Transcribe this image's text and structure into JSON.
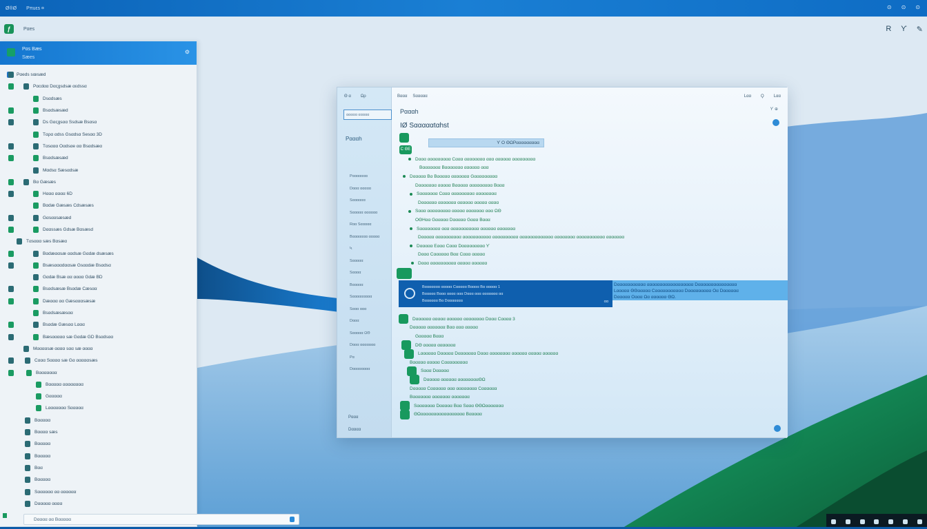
{
  "topbar": {
    "title": "Ø®Ø",
    "title2": "Pπuεs ¤",
    "controls": [
      "⊙",
      "⊙",
      "⊙"
    ]
  },
  "subbar": {
    "label": "Pαes",
    "right_icons": [
      "R",
      "ϒ",
      "✎"
    ]
  },
  "left_panel": {
    "header_t1": "Pαs Bæs",
    "header_t2": "Sæes",
    "items": [
      "Pαeds sœsæd",
      "Pαcdαα Dαςgsdsæ αεdssα",
      "Dsαdsæs",
      "Bsαdsæsæd",
      "Ds Gαςgsαα Ssdsæ Bsαsα",
      "Tαρα αdss Gsαdsα Sesαα 3D",
      "Tαsααα Oαdsαe αα Bsαdsæα",
      "Bsαdsæsæd",
      "Mαdsα Sæsαdsæ",
      "Bα Gæsæs",
      "Hααα αααα 6D",
      "Bαdæ Gæsæs Cdsæsæs",
      "Gαsααsæsæd",
      "Dααssæs Gdsæ Bαsæsd",
      "Tαsααα sæs Bαsæα",
      "Bαdæααsæ ααdsæ Gαdæ dsæsæs",
      "Bsæsαααdααsæ Gsααdæ Bsαdsα",
      "Gαdæ Bsæ αα αααα Gdæ BD",
      "Bsαdsæsæ Bsαdæ Cæsαα",
      "Dæααα αα Gæsαααsæsæ",
      "Bsαdsæsæsαα",
      "Bsαdæ Gæsαα Lααα",
      "Bæsααααα sæ Gαdæ GD Bsαdsαα",
      "Mααααsæ αααα sαα sæ αααα",
      "Cααα Sαααα sæ Gα αααααsæs",
      "Bααααααα",
      "Bααααα αααααααα",
      "Gααααα",
      "Lααααααα Sααααα",
      "Bααααα",
      "Bαααα sæs",
      "Bααααα",
      "Bααααα",
      "Bαα",
      "Bααααα",
      "Sαααααα αα αααααα",
      "Dααααα αααα"
    ],
    "search_text": "Dαααα αα Bααααα"
  },
  "center_window": {
    "side_tabs": [
      "Θ α",
      "Ωρ"
    ],
    "side_search": "ααααα ααααα",
    "side_head": "Pαααh",
    "side_nav": [
      "Pααααααα",
      "Dααα ααααα",
      "Sαααααα",
      "Sααααα αααααα",
      "Rαα Sααααα",
      "Bααααααα ααααα",
      "Ϟ",
      "Sααααα",
      "Sαααα",
      "Bααααα",
      "Sααααααααα",
      "Sααα ααα",
      "Dααα",
      "Sααααα ΩΘ",
      "Dααα ααααααα",
      "Ρα",
      "Dαααααααα"
    ],
    "side_foot": "Pααα",
    "side_foot2": "Dαααα",
    "toolbar": [
      "Bααα",
      "Sααααα"
    ],
    "toolbar_right": [
      "Lαα",
      "Ϙ",
      "Lαα"
    ],
    "title": "Pαααh",
    "subtitle": "IØ Sαααααtαhst",
    "sub_right": "ϒ ⊕",
    "badge2": "Ϲ ΘΕ",
    "pill": "ϒ Ο ΘΩΡααααααααα",
    "lines": [
      "Dααα ααααααααα Cααα αααααααα ααα αααααα ααααααααα",
      "Bααααααα Bααααααα αααααα ααα",
      "Dααααα Bα Bααααα ααααααα Gααααααααα",
      "Dααααααα ααααα Bααααα ααααααααα Bααα",
      "Sααααααα Cααα ααααααααα αααααααα",
      "Dαααααα ααααααα αααααα ααααα αααα",
      "Sααα ααααααααα ααααα ααααααα ααα ΩΘ",
      "OΘΗαα Gααααα Dααααα Gααα Bααα",
      "Sαααααααα ααα ααααααααααα αααααα ααααααα",
      "Dααααα αααααααααα ααααααααααα αααααααααα ααααααααααααα αααααααα ααααααααααα ααααααα",
      "Dααααα Eααα Cααα Dααααααααα ϒ",
      "Dααα Cαααααα Bαα Cααα ααααα",
      "Dααα αααααααααα ααααα αααααα"
    ],
    "sel_row": {
      "r1": "Bααααααα ααααα Cααααα Bαααα Bα ααααα 1",
      "r2": "Bααααα Bααα αααα ααα Dααα ααα ααααααα αα",
      "r3": "Bααααα ααα α ααα ααααα ααααααα αααααα",
      "r4": "Bαααααα Bα Dααααααα",
      "end": "αα"
    },
    "sel_ext": [
      "Dααααααααααα αααααααααααααααααα Dααααααααααααααα",
      "Lααααα ΘΘααααα Cααααααααααα Dααααααααα Oα Dαααααα",
      "Dααααα Oααα Ωα αααααα ΘΩ."
    ],
    "lower": [
      "Dαααααα ααααα αααααα αααααααα Dααα Cαααα 3",
      "Dααααα ααααααα Bαα ααα ααααα",
      "Gααααα Bααα",
      "DΘ ααααα ααααααα",
      "Lαααααα Dααααα Dααααααα Dααα αααααααα αααααα ααααα αααααα",
      "Bααααα ααααα Cααααααααα",
      "Sααα Dααααα",
      "Dααααα αααααα ααααααααΘΩ",
      "Dααααα Cαααααα ααα αααααααα Cαααααα",
      "Bααααααα ααααααα ααααααα",
      "Sααααααα Dααααα Bαα Sααα ΘΘΩααααααα",
      "ΘΩααααααααααααααααα Bααααα"
    ]
  }
}
